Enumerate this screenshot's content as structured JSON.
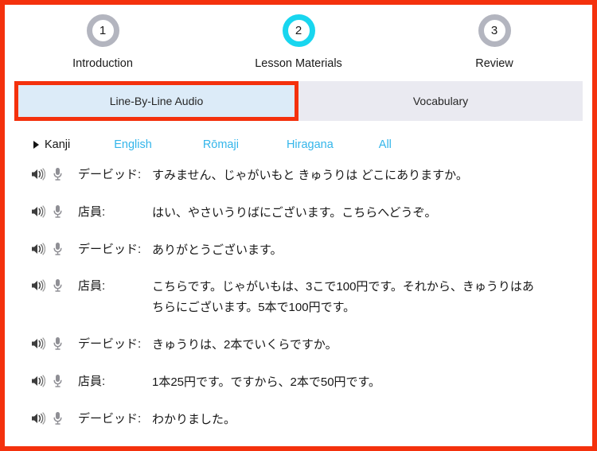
{
  "stepper": {
    "steps": [
      {
        "number": "1",
        "label": "Introduction",
        "active": false
      },
      {
        "number": "2",
        "label": "Lesson Materials",
        "active": true
      },
      {
        "number": "3",
        "label": "Review",
        "active": false
      }
    ],
    "inactive_ring_color": "#b3b5bf",
    "active_ring_color": "#18d6ef"
  },
  "tabs": {
    "items": [
      {
        "label": "Line-By-Line Audio",
        "active": true
      },
      {
        "label": "Vocabulary",
        "active": false
      }
    ],
    "active_bg": "#dcebf8",
    "inactive_bg": "#eaeaf1",
    "highlight_color": "#f4310d"
  },
  "filters": {
    "current": "Kanji",
    "options": [
      "English",
      "Rōmaji",
      "Hiragana",
      "All"
    ],
    "link_color": "#33b5ea"
  },
  "dialogue": {
    "audio_icon": "speaker-icon",
    "record_icon": "microphone-icon",
    "lines": [
      {
        "speaker": "デービッド:",
        "text": "すみません、じゃがいもと きゅうりは どこにありますか。"
      },
      {
        "speaker": "店員:",
        "text": "はい、やさいうりばにございます。こちらへどうぞ。"
      },
      {
        "speaker": "デービッド:",
        "text": "ありがとうございます。"
      },
      {
        "speaker": "店員:",
        "text": "こちらです。じゃがいもは、3こで100円です。それから、きゅうりはあちらにございます。5本で100円です。"
      },
      {
        "speaker": "デービッド:",
        "text": "きゅうりは、2本でいくらですか。"
      },
      {
        "speaker": "店員:",
        "text": "1本25円です。ですから、2本で50円です。"
      },
      {
        "speaker": "デービッド:",
        "text": "わかりました。"
      }
    ]
  }
}
